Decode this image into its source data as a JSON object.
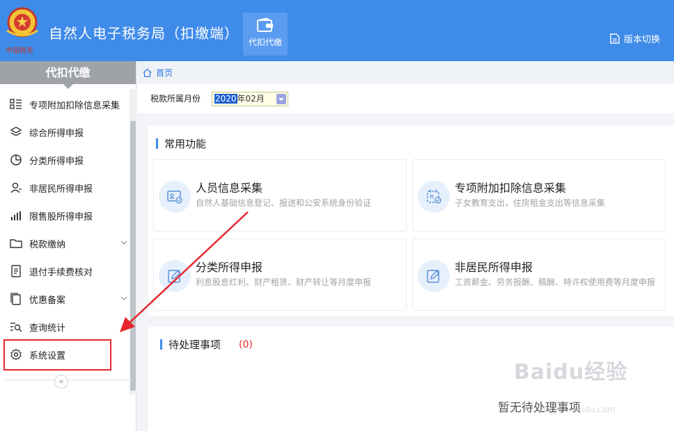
{
  "header": {
    "logo_text": "中国税务",
    "title": "自然人电子税务局（扣缴端）",
    "nav_tab_label": "代扣代缴",
    "version_switch_label": "版本切换"
  },
  "sidebar": {
    "title": "代扣代缴",
    "items": [
      {
        "label": "专项附加扣除信息采集",
        "icon": "grid-list-icon"
      },
      {
        "label": "综合所得申报",
        "icon": "layers-icon"
      },
      {
        "label": "分类所得申报",
        "icon": "pie-chart-icon"
      },
      {
        "label": "非居民所得申报",
        "icon": "person-icon"
      },
      {
        "label": "限售股所得申报",
        "icon": "bar-chart-icon"
      },
      {
        "label": "税款缴纳",
        "icon": "folder-icon"
      },
      {
        "label": "退付手续费核对",
        "icon": "document-icon"
      },
      {
        "label": "优惠备案",
        "icon": "copy-icon"
      },
      {
        "label": "查询统计",
        "icon": "search-list-icon"
      },
      {
        "label": "系统设置",
        "icon": "gear-icon"
      }
    ],
    "collapse_label": "«"
  },
  "breadcrumb": {
    "home": "首页"
  },
  "filter": {
    "label": "税款所属月份",
    "year": "2020",
    "month": "年02月"
  },
  "common": {
    "title": "常用功能",
    "cards": [
      {
        "title": "人员信息采集",
        "desc": "自然人基础信息登记、报送和公安系统身份验证"
      },
      {
        "title": "专项附加扣除信息采集",
        "desc": "子女教育支出，住房租金支出等信息采集"
      },
      {
        "title": "分类所得申报",
        "desc": "利息股息红利、财产租赁、财产转让等月度申报"
      },
      {
        "title": "非居民所得申报",
        "desc": "工资薪金、劳务报酬、稿酬、特许权使用费等月度申报"
      }
    ]
  },
  "pending": {
    "title": "待处理事项",
    "count": "(0)",
    "empty_text": "暂无待处理事项"
  },
  "watermark": {
    "text": "Baidu经验",
    "sub": "jingyan.baidu.com"
  },
  "colors": {
    "header": "#3f8bea",
    "accent_red": "#e5262b",
    "sidebar_head": "#9fa3a8"
  }
}
